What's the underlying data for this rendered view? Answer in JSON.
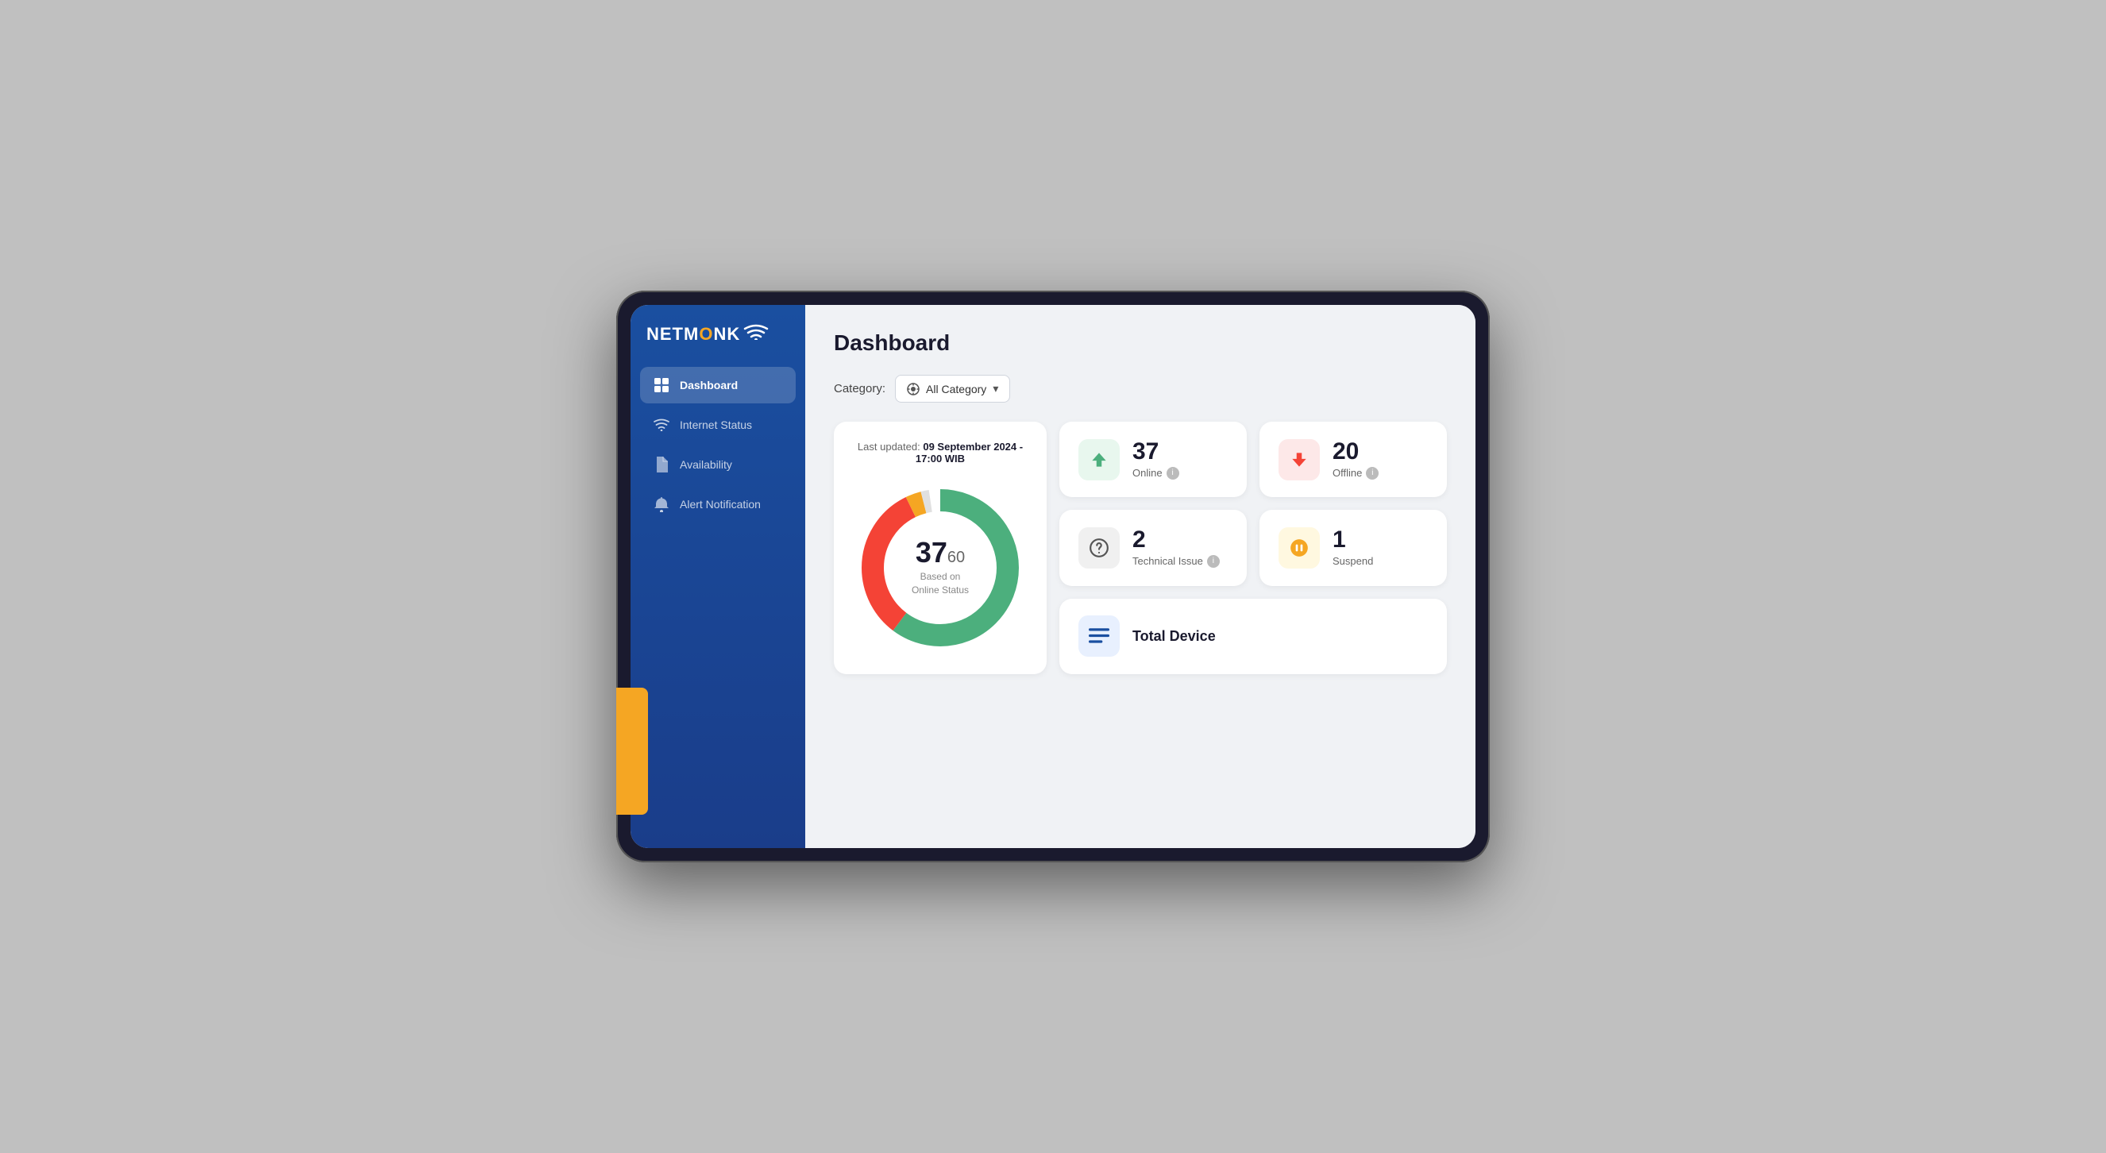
{
  "app": {
    "name": "NETMONK",
    "logo_suffix": "H≈"
  },
  "sidebar": {
    "items": [
      {
        "id": "dashboard",
        "label": "Dashboard",
        "active": true
      },
      {
        "id": "internet-status",
        "label": "Internet Status",
        "active": false
      },
      {
        "id": "availability",
        "label": "Availability",
        "active": false
      },
      {
        "id": "alert-notification",
        "label": "Alert Notification",
        "active": false
      }
    ]
  },
  "header": {
    "title": "Dashboard"
  },
  "toolbar": {
    "category_label": "Category:",
    "category_value": "All Category",
    "dropdown_arrow": "▾"
  },
  "donut_chart": {
    "last_updated_prefix": "Last updated:",
    "last_updated_value": "09 September 2024 - 17:00 WIB",
    "current": 37,
    "total": 60,
    "sub_label_line1": "Based on",
    "sub_label_line2": "Online Status",
    "segments": [
      {
        "label": "Online",
        "value": 37,
        "color": "#4caf7d",
        "percentage": 61.7
      },
      {
        "label": "Offline",
        "value": 20,
        "color": "#f44336",
        "percentage": 33.3
      },
      {
        "label": "Technical Issue",
        "value": 2,
        "color": "#f5a623",
        "percentage": 3.3
      },
      {
        "label": "Suspend",
        "value": 1,
        "color": "#cccccc",
        "percentage": 1.7
      }
    ]
  },
  "stat_cards": [
    {
      "id": "online",
      "number": "37",
      "label": "Online",
      "icon_type": "arrow-up",
      "icon_color": "#4caf7d",
      "bg_class": "green",
      "has_info": true
    },
    {
      "id": "offline",
      "number": "20",
      "label": "Offline",
      "icon_type": "arrow-down",
      "icon_color": "#f44336",
      "bg_class": "red",
      "has_info": true
    },
    {
      "id": "technical-issue",
      "number": "2",
      "label": "Technical Issue",
      "icon_type": "question",
      "icon_color": "#555",
      "bg_class": "gray",
      "has_info": true
    },
    {
      "id": "suspend",
      "number": "1",
      "label": "Suspend",
      "icon_type": "pause",
      "icon_color": "#f5a623",
      "bg_class": "yellow",
      "has_info": false
    }
  ],
  "total_device": {
    "label": "Total Device",
    "icon_type": "menu",
    "bg_class": "blue",
    "icon_color": "#1a4fa0"
  }
}
